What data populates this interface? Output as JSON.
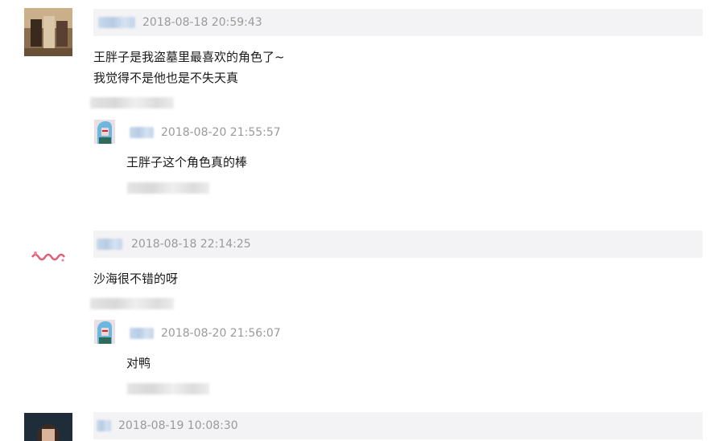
{
  "comments": [
    {
      "timestamp": "2018-08-18 20:59:43",
      "lines": [
        "王胖子是我盗墓里最喜欢的角色了~",
        "我觉得不是他也是不失天真"
      ],
      "reply": {
        "timestamp": "2018-08-20 21:55:57",
        "text": "王胖子这个角色真的棒"
      }
    },
    {
      "timestamp": "2018-08-18 22:14:25",
      "lines": [
        "沙海很不错的呀"
      ],
      "reply": {
        "timestamp": "2018-08-20 21:56:07",
        "text": "对鸭"
      }
    },
    {
      "timestamp": "2018-08-19 10:08:30"
    }
  ],
  "colors": {
    "header_bg": "#f3f3f5",
    "timestamp": "#9a9a9a",
    "text": "#1a1a1a",
    "blur_name": "#c9d9ec"
  }
}
